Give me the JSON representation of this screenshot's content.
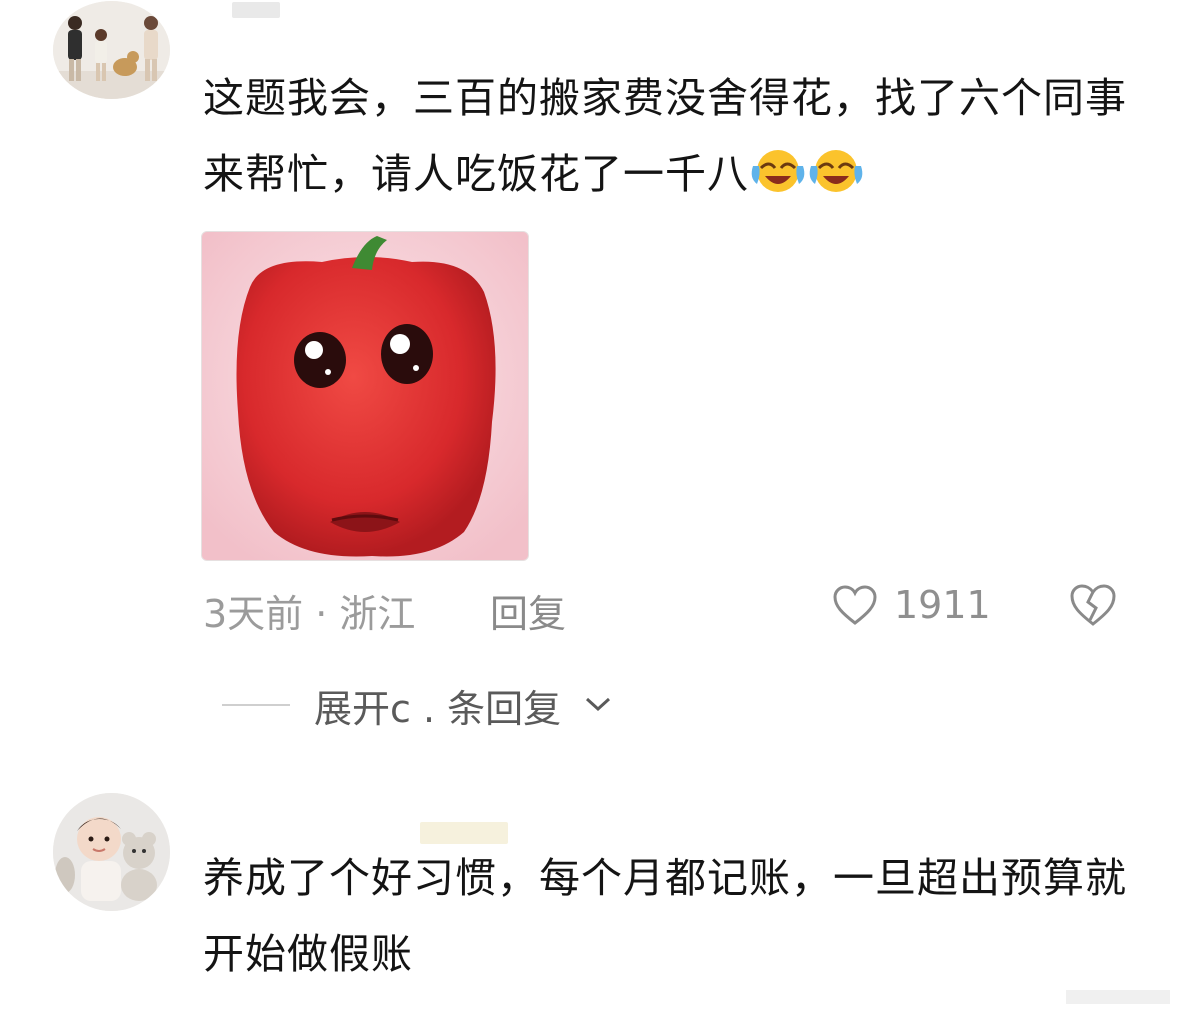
{
  "comments": [
    {
      "text": "这题我会，三百的搬家费没舍得花，找了六个同事来帮忙，请人吃饭花了一千八",
      "emoji": [
        "laughing-crying-emoji",
        "laughing-crying-emoji"
      ],
      "meta": "3天前 · 浙江",
      "reply_label": "回复",
      "likes": "1911",
      "expand_label": "展开\u0000条回复"
    },
    {
      "text": "养成了个好习惯，每个月都记账，一旦超出预算就开始做假账"
    }
  ],
  "icons": {
    "like": "heart-outline-icon",
    "dislike": "broken-heart-icon",
    "expand": "chevron-down-icon"
  },
  "colors": {
    "text": "#141414",
    "meta": "#9b9b9b",
    "sticker_bg": "#f6d4da",
    "pepper": "#d8292c"
  }
}
